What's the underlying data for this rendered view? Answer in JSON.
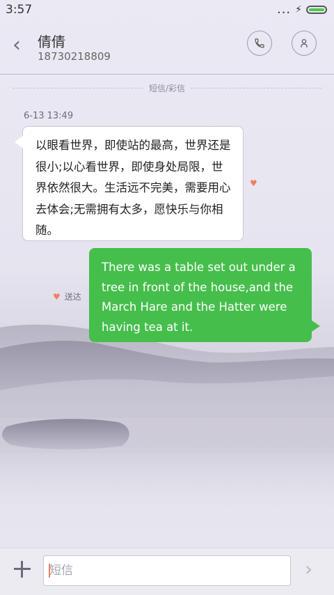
{
  "status_bar": {
    "time": "3:57",
    "signal_dots": "...",
    "bolt": "⚡"
  },
  "header": {
    "contact_name": "倩倩",
    "contact_number": "18730218809",
    "back_icon": "chevron-left-icon",
    "call_icon": "phone-icon",
    "profile_icon": "person-icon"
  },
  "conversation": {
    "channel_label": "短信/彩信",
    "timestamp": "6-13 13:49",
    "messages": [
      {
        "direction": "incoming",
        "text": "以眼看世界，即使站的最高，世界还是很小;以心看世界，即使身处局限，世界依然很大。生活远不完美，需要用心去体会;无需拥有太多，愿快乐与你相随。"
      },
      {
        "direction": "outgoing",
        "text": "There was a table set out under a tree in front of the house,and the March Hare and the Hatter were having tea at it.",
        "status": "送达"
      }
    ],
    "heart_symbol": "♥"
  },
  "input_bar": {
    "placeholder": "短信",
    "value": "",
    "add_icon": "plus-icon",
    "send_icon": "chevron-right-icon",
    "send_symbol": "›"
  },
  "colors": {
    "outgoing_bubble": "#46be4c",
    "accent": "#ee7f62"
  }
}
